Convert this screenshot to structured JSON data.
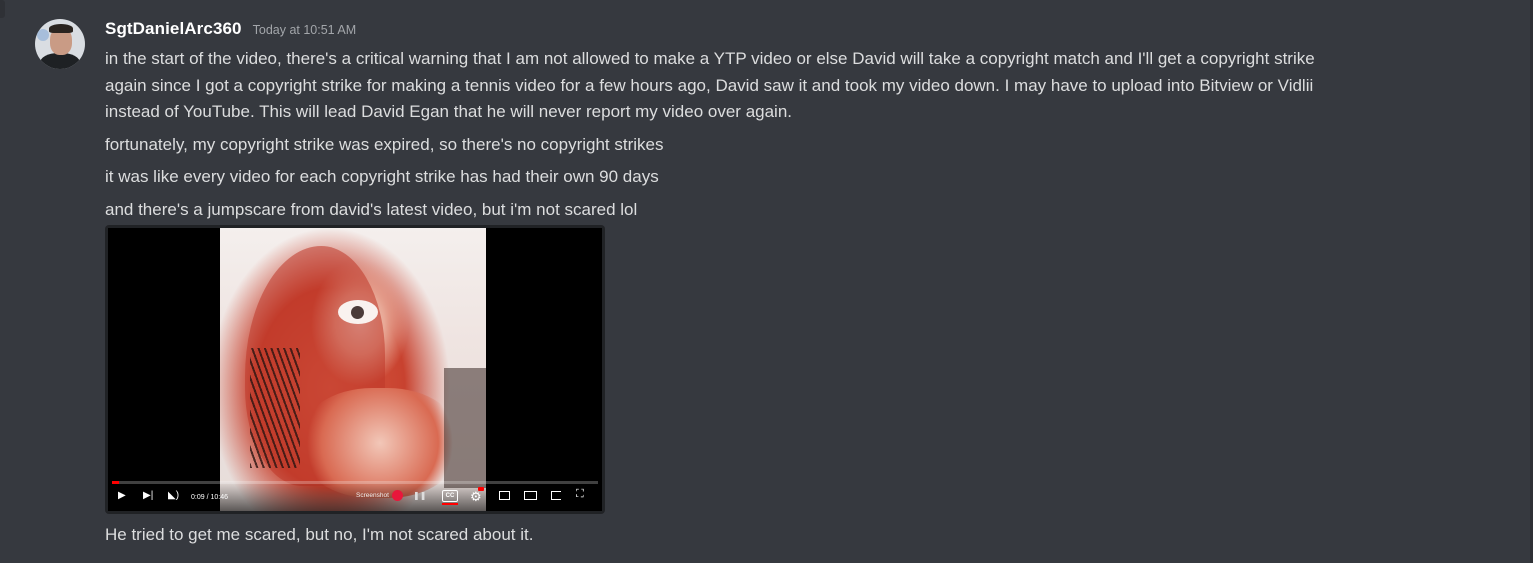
{
  "message": {
    "username": "SgtDanielArc360",
    "timestamp": "Today at 10:51 AM",
    "lines": [
      "in the start of the video, there's a critical warning that I am not allowed to make a YTP video or else David will take a copyright match and I'll get a copyright strike",
      "again since I got a copyright strike for making a tennis video for a few hours ago, David saw it and took my video down. I may have to upload into Bitview or Vidlii",
      "instead of YouTube. This will lead David Egan that he will never report my video over again."
    ],
    "follow_ups": [
      "fortunately, my copyright strike was expired, so there's no copyright strikes",
      "it was like every video for each copyright strike has had their own 90 days",
      "and there's a jumpscare from david's latest video, but i'm not scared lol"
    ],
    "attachment": {
      "type": "screenshot of video player",
      "time_display": "0:09 / 10:46",
      "screenshot_label": "Screenshot",
      "cc_label": "CC",
      "progress_fraction": 0.014
    },
    "final_line": "He tried to get me scared, but no, I'm not scared about it."
  },
  "icons": {
    "play": "play-icon",
    "next": "next-icon",
    "volume": "volume-icon",
    "settings": "gear-icon",
    "miniplayer": "miniplayer-icon",
    "theater": "theater-icon",
    "cast": "cast-icon",
    "fullscreen": "fullscreen-icon"
  },
  "colors": {
    "background": "#36393f",
    "username": "#ffffff",
    "text": "#dcddde",
    "timestamp": "#a3a6aa",
    "progress": "#ff0000"
  }
}
